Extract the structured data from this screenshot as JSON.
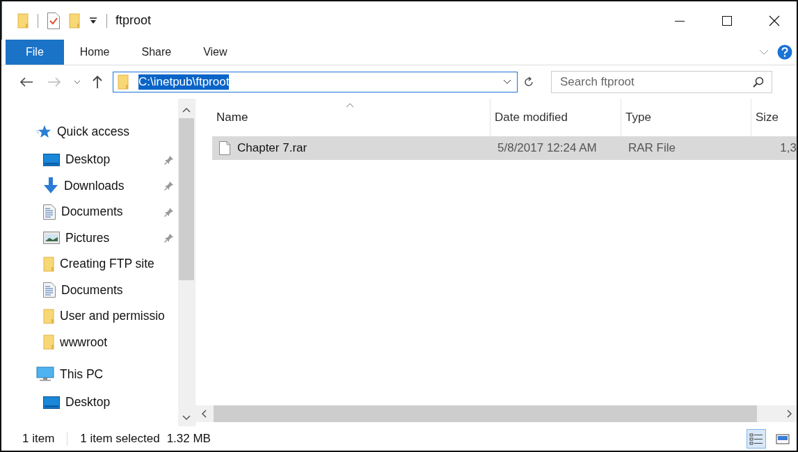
{
  "window": {
    "title": "ftproot"
  },
  "ribbon_tabs": [
    {
      "label": "File",
      "kind": "file",
      "selected": false
    },
    {
      "label": "Home",
      "kind": "tab",
      "selected": false
    },
    {
      "label": "Share",
      "kind": "tab",
      "selected": false
    },
    {
      "label": "View",
      "kind": "tab",
      "selected": false
    }
  ],
  "address_bar": {
    "value": "C:\\inetpub\\ftproot",
    "selected": true
  },
  "search": {
    "placeholder": "Search ftproot"
  },
  "navigation": [
    {
      "label": "Quick access",
      "kind": "star",
      "children": [
        {
          "label": "Desktop",
          "kind": "desktop",
          "pinned": true
        },
        {
          "label": "Downloads",
          "kind": "download",
          "pinned": true
        },
        {
          "label": "Documents",
          "kind": "document",
          "pinned": true
        },
        {
          "label": "Pictures",
          "kind": "picture",
          "pinned": true
        },
        {
          "label": "Creating FTP site",
          "kind": "folder",
          "pinned": false
        },
        {
          "label": "Documents",
          "kind": "document",
          "pinned": false
        },
        {
          "label": "User and permissio",
          "kind": "folder",
          "pinned": false
        },
        {
          "label": "wwwroot",
          "kind": "folder",
          "pinned": false
        }
      ]
    },
    {
      "label": "This PC",
      "kind": "pc",
      "children": [
        {
          "label": "Desktop",
          "kind": "desktop",
          "pinned": false
        }
      ]
    }
  ],
  "file_list": {
    "columns": [
      {
        "label": "Name",
        "sorted": true
      },
      {
        "label": "Date modified",
        "sorted": false
      },
      {
        "label": "Type",
        "sorted": false
      },
      {
        "label": "Size",
        "sorted": false
      }
    ],
    "rows": [
      {
        "name": "Chapter 7.rar",
        "date_modified": "5/8/2017 12:24 AM",
        "type": "RAR File",
        "size": "1,3",
        "selected": true
      }
    ]
  },
  "status_bar": {
    "item_count": "1 item",
    "selection": "1 item selected",
    "selection_size": "1.32 MB"
  },
  "view_buttons": [
    {
      "kind": "details",
      "selected": true
    },
    {
      "kind": "large_icons",
      "selected": false
    }
  ]
}
